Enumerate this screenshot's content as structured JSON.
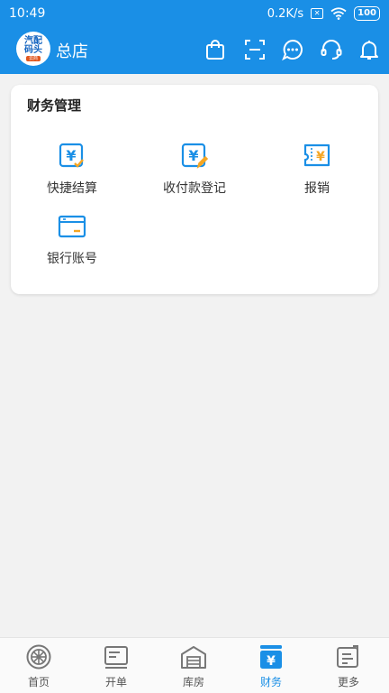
{
  "status_bar": {
    "time": "10:49",
    "network_speed": "0.2K/s",
    "battery": "100"
  },
  "header": {
    "logo_text": "汽配码头",
    "logo_tag": "云商",
    "store_name": "总店"
  },
  "finance_card": {
    "title": "财务管理",
    "items": [
      {
        "label": "快捷结算",
        "icon": "quick-settle-icon"
      },
      {
        "label": "收付款登记",
        "icon": "payment-register-icon"
      },
      {
        "label": "报销",
        "icon": "reimbursement-icon"
      },
      {
        "label": "银行账号",
        "icon": "bank-card-icon"
      }
    ]
  },
  "tabbar": {
    "items": [
      {
        "label": "首页",
        "icon": "home-wheel-icon"
      },
      {
        "label": "开单",
        "icon": "order-icon"
      },
      {
        "label": "库房",
        "icon": "warehouse-icon"
      },
      {
        "label": "财务",
        "icon": "finance-icon",
        "active": true
      },
      {
        "label": "更多",
        "icon": "more-icon"
      }
    ]
  },
  "colors": {
    "primary": "#1a8fe6",
    "icon_accent": "#f5a623",
    "icon_blue": "#1a8fe6"
  }
}
